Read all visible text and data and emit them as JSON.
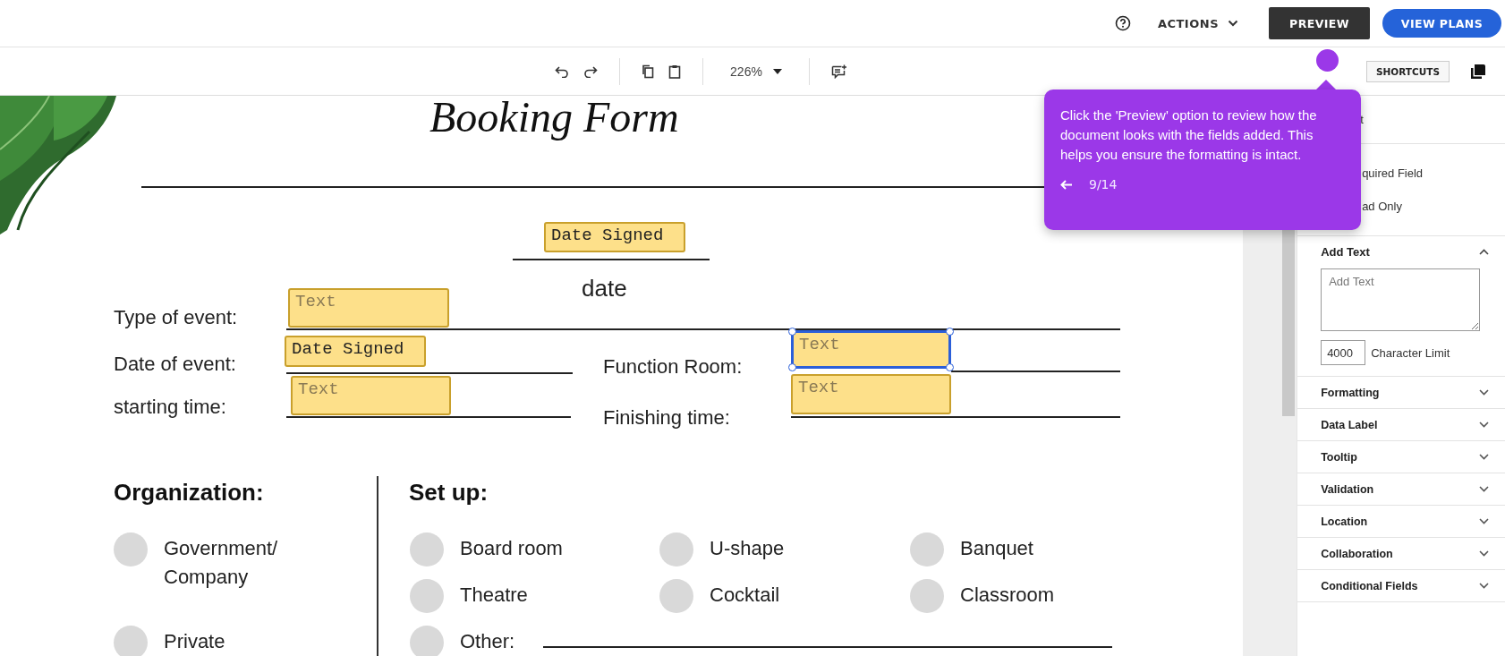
{
  "top_bar": {
    "actions": "ACTIONS",
    "buttons": [
      {
        "label": "PREVIEW",
        "kind": "dark"
      },
      {
        "label": "VIEW PLANS",
        "kind": "primary"
      }
    ]
  },
  "toolbar": {
    "zoom": "226%",
    "shortcuts": "SHORTCUTS"
  },
  "document": {
    "title": "Booking Form",
    "header_field": {
      "text": "Date Signed",
      "kind": "value",
      "selected": false
    },
    "caption": "date",
    "labels": [
      "Type of event:",
      "Date of event:",
      "starting time:",
      "Function Room:",
      "Finishing time:"
    ],
    "fields": [
      {
        "text": "Text",
        "kind": "placeholder",
        "selected": false
      },
      {
        "text": "Date Signed",
        "kind": "value",
        "selected": false
      },
      {
        "text": "Text",
        "kind": "placeholder",
        "selected": false
      },
      {
        "text": "Text",
        "kind": "placeholder",
        "selected": true
      },
      {
        "text": "Text",
        "kind": "placeholder",
        "selected": false
      }
    ],
    "organization": {
      "title": "Organization:",
      "options": [
        {
          "label": "Government/ Company",
          "selected": false
        },
        {
          "label": "Private",
          "selected": false
        }
      ]
    },
    "setup": {
      "title": "Set up:",
      "options": [
        {
          "label": "Board room",
          "selected": false
        },
        {
          "label": "U-shape",
          "selected": false
        },
        {
          "label": "Banquet",
          "selected": false
        },
        {
          "label": "Theatre",
          "selected": false
        },
        {
          "label": "Cocktail",
          "selected": false
        },
        {
          "label": "Classroom",
          "selected": false
        },
        {
          "label": "Other:",
          "selected": false
        }
      ]
    }
  },
  "tooltip": {
    "text": "Click the 'Preview' option to review how the document looks with the fields added. This helps you ensure the formatting is intact.",
    "step": "9/14"
  },
  "panel": {
    "header": "t",
    "checks": [
      "quired Field",
      "ad Only"
    ],
    "add_text": {
      "title": "Add Text",
      "expanded": true,
      "placeholder": "Add Text",
      "limit": "4000",
      "limit_label": "Character Limit"
    },
    "sections": [
      {
        "title": "Formatting",
        "expanded": false
      },
      {
        "title": "Data Label",
        "expanded": false
      },
      {
        "title": "Tooltip",
        "expanded": false
      },
      {
        "title": "Validation",
        "expanded": false
      },
      {
        "title": "Location",
        "expanded": false
      },
      {
        "title": "Collaboration",
        "expanded": false
      },
      {
        "title": "Conditional Fields",
        "expanded": false
      }
    ]
  }
}
